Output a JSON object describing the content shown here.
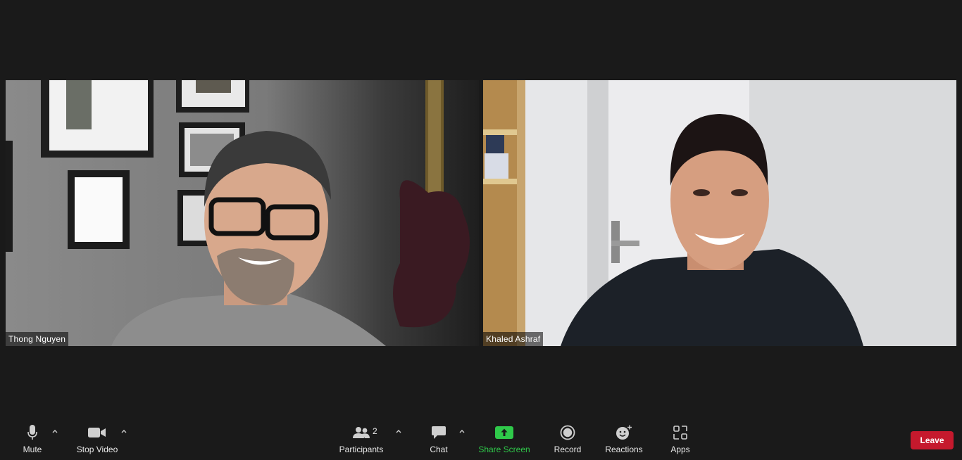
{
  "participants": [
    {
      "name": "Thong Nguyen"
    },
    {
      "name": "Khaled Ashraf"
    }
  ],
  "toolbar": {
    "mute_label": "Mute",
    "stop_video_label": "Stop Video",
    "participants_label": "Participants",
    "participants_count": "2",
    "chat_label": "Chat",
    "share_screen_label": "Share Screen",
    "record_label": "Record",
    "reactions_label": "Reactions",
    "apps_label": "Apps",
    "leave_label": "Leave"
  },
  "colors": {
    "background": "#1a1a1a",
    "share_green": "#2fc94a",
    "leave_red": "#c5192d"
  },
  "icons": [
    "microphone-icon",
    "video-camera-icon",
    "participants-icon",
    "chat-bubble-icon",
    "share-screen-icon",
    "record-icon",
    "reactions-icon",
    "apps-icon",
    "caret-up-icon"
  ]
}
